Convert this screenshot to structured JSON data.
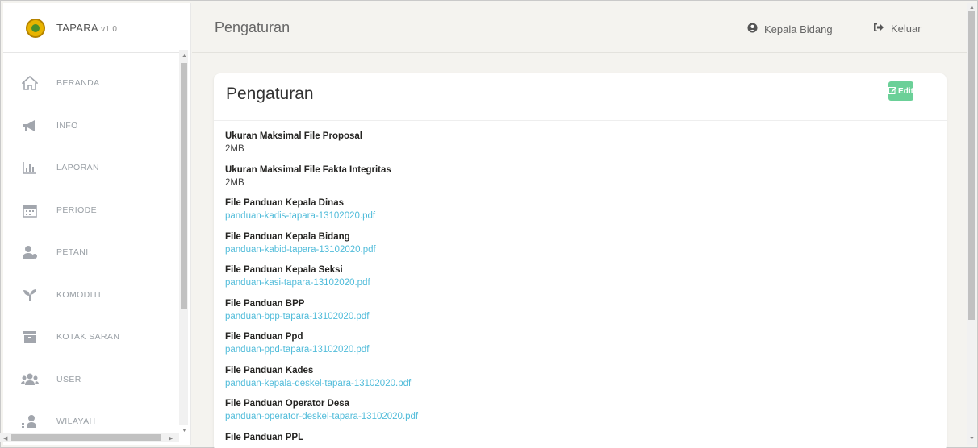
{
  "app": {
    "name": "TAPARA",
    "version": "v1.0"
  },
  "sidebar": {
    "items": [
      {
        "label": "BERANDA",
        "icon": "home-icon"
      },
      {
        "label": "INFO",
        "icon": "megaphone-icon"
      },
      {
        "label": "LAPORAN",
        "icon": "bar-chart-icon"
      },
      {
        "label": "PERIODE",
        "icon": "calendar-icon"
      },
      {
        "label": "PETANI",
        "icon": "farmer-icon"
      },
      {
        "label": "KOMODITI",
        "icon": "sprout-icon"
      },
      {
        "label": "KOTAK SARAN",
        "icon": "archive-box-icon"
      },
      {
        "label": "USER",
        "icon": "users-icon"
      },
      {
        "label": "WILAYAH",
        "icon": "region-icon"
      }
    ]
  },
  "header": {
    "title": "Pengaturan",
    "user_label": "Kepala Bidang",
    "logout_label": "Keluar"
  },
  "card": {
    "title": "Pengaturan",
    "edit_label": "Edit",
    "settings": [
      {
        "label": "Ukuran Maksimal File Proposal",
        "value": "2MB"
      },
      {
        "label": "Ukuran Maksimal File Fakta Integritas",
        "value": "2MB"
      },
      {
        "label": "File Panduan Kepala Dinas",
        "value": "panduan-kadis-tapara-13102020.pdf"
      },
      {
        "label": "File Panduan Kepala Bidang",
        "value": "panduan-kabid-tapara-13102020.pdf"
      },
      {
        "label": "File Panduan Kepala Seksi",
        "value": "panduan-kasi-tapara-13102020.pdf"
      },
      {
        "label": "File Panduan BPP",
        "value": "panduan-bpp-tapara-13102020.pdf"
      },
      {
        "label": "File Panduan Ppd",
        "value": "panduan-ppd-tapara-13102020.pdf"
      },
      {
        "label": "File Panduan Kades",
        "value": "panduan-kepala-deskel-tapara-13102020.pdf"
      },
      {
        "label": "File Panduan Operator Desa",
        "value": "panduan-operator-deskel-tapara-13102020.pdf"
      },
      {
        "label": "File Panduan PPL",
        "value": ""
      }
    ]
  },
  "colors": {
    "edit_button": "#6bd098",
    "link": "#51bcda",
    "background": "#f4f3ef"
  }
}
